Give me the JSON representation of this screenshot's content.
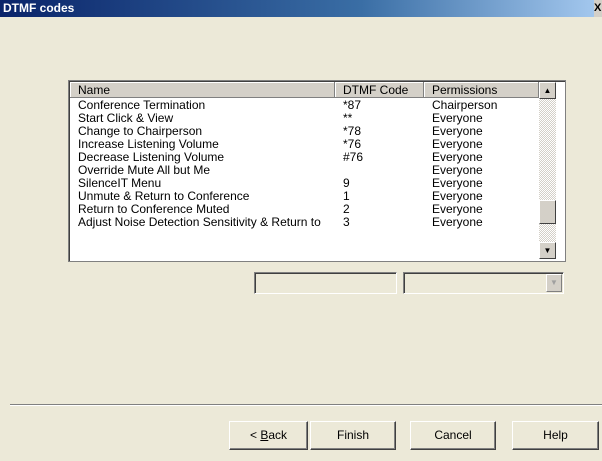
{
  "window": {
    "title": "DTMF codes",
    "close_glyph": "X"
  },
  "table": {
    "columns": [
      "Name",
      "DTMF Code",
      "Permissions"
    ],
    "rows": [
      [
        "Conference Termination",
        "*87",
        "Chairperson"
      ],
      [
        "Start Click & View",
        "**",
        "Everyone"
      ],
      [
        "Change to Chairperson",
        "*78",
        "Everyone"
      ],
      [
        "Increase Listening Volume",
        "*76",
        "Everyone"
      ],
      [
        "Decrease Listening Volume",
        "#76",
        "Everyone"
      ],
      [
        "Override Mute All but Me",
        "",
        "Everyone"
      ],
      [
        "SilenceIT Menu",
        "9",
        "Everyone"
      ],
      [
        "Unmute & Return to Conference",
        "1",
        "Everyone"
      ],
      [
        "Return to Conference Muted",
        "2",
        "Everyone"
      ],
      [
        "Adjust Noise Detection Sensitivity & Return to",
        "3",
        "Everyone"
      ]
    ],
    "scroll_up_icon": "▲",
    "scroll_down_icon": "▼"
  },
  "edit": {
    "code_value": "",
    "permission_value": ""
  },
  "buttons": {
    "back_prefix": "< ",
    "back_mnemonic": "B",
    "back_rest": "ack",
    "finish": "Finish",
    "cancel": "Cancel",
    "help": "Help"
  }
}
